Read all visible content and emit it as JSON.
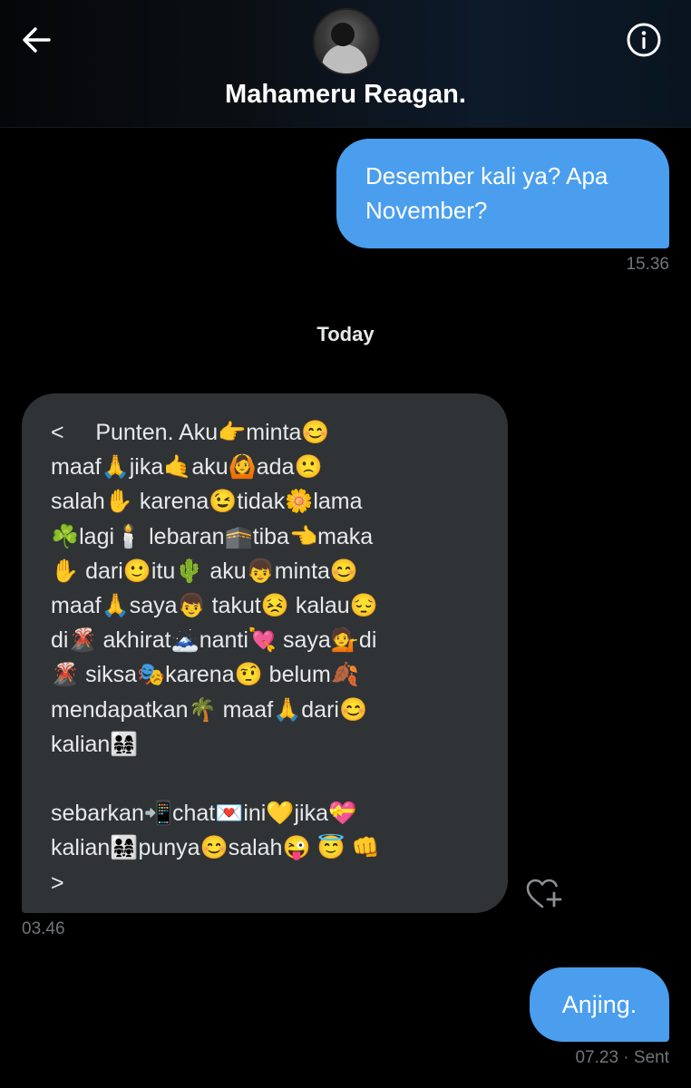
{
  "header": {
    "contact_name": "Mahameru Reagan.",
    "back_icon": "arrow-left-icon",
    "info_icon": "info-icon"
  },
  "messages": [
    {
      "direction": "outgoing",
      "text": "Desember kali ya? Apa\nNovember?",
      "time": "15.36"
    },
    {
      "direction": "incoming",
      "text": "<     Punten. Aku👉minta😊\nmaaf🙏jika🤙aku🙆ada🙁\nsalah✋ karena😉tidak🌼lama\n☘️lagi🕯️ lebaran🕋tiba👈maka\n✋ dari🙂itu🌵 aku👦minta😊\nmaaf🙏saya👦 takut😣 kalau😔\ndi🌋 akhirat🗻nanti💘 saya💁di\n🌋 siksa🎭karena🤨 belum🍂\nmendapatkan🌴 maaf🙏dari😊\nkalian👨‍👩‍👧‍👧\n\nsebarkan📲chat💌ini💛jika💝\nkalian👨‍👩‍👧‍👧punya😊salah😜 😇 👊\n>",
      "time": "03.46"
    },
    {
      "direction": "outgoing",
      "text": "Anjing.",
      "time": "07.23 · Sent"
    }
  ],
  "date_separator": "Today",
  "react_icon": "heart-plus-icon",
  "colors": {
    "outgoing_bubble": "#4a9eed",
    "incoming_bubble": "#2f3336",
    "background": "#000000",
    "timestamp": "#71767b"
  }
}
